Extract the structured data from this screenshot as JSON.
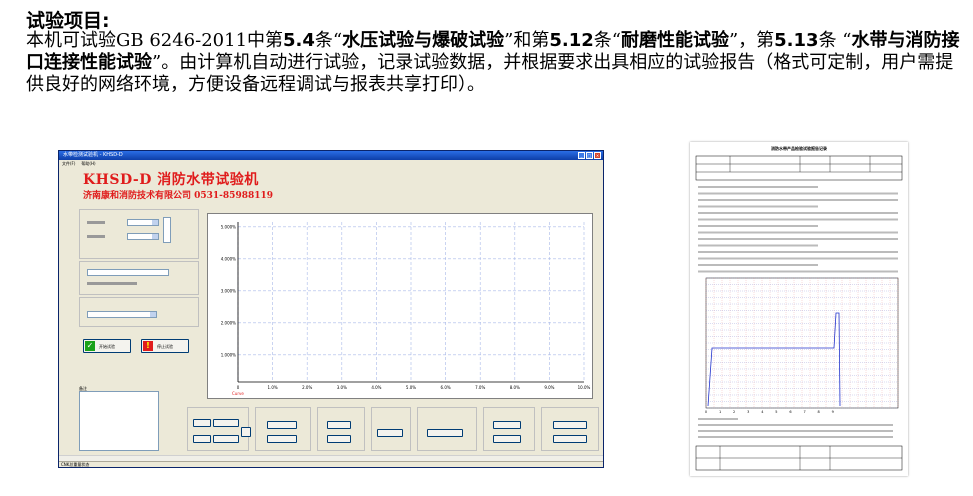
{
  "heading": "试验项目:",
  "paragraph": {
    "p1": "本机可试验GB 6246-2011中第",
    "s1": "5.4",
    "p2": "条“",
    "b1": "水压试验与爆破试验",
    "p3": "”和第",
    "s2": "5.12",
    "p4": "条“",
    "b2": "耐磨性能试验",
    "p5": "”，第",
    "s3": "5.13",
    "p6": "条 “",
    "b3": "水带与消防接口连接性能试验",
    "p7": "”。由计算机自动进行试验，记录试验数据，并根据要求出具相应的试验报告（格式可定制，用户需提供良好的网络环境，方便设备远程调试与报表共享打印）。"
  },
  "software": {
    "title_text": "水带检测试验机 - KHSD-D",
    "menu": [
      "文件(F)",
      "帮助(H)"
    ],
    "logo_name": "KHSD-D 消防水带试验机",
    "logo_company": "济南康和消防技术有限公司 0531-85988119",
    "start_button": "开始试验",
    "stop_button": "停止试验",
    "remarks_label": "备注",
    "status_text": "CNK总重量状态",
    "y_ticks": [
      "5.000%",
      "4.000%",
      "3.000%",
      "2.000%",
      "1.000%"
    ],
    "x_ticks": [
      "0",
      "1.0%",
      "2.0%",
      "3.0%",
      "4.0%",
      "5.0%",
      "6.0%",
      "7.0%",
      "8.0%",
      "9.0%",
      "10.0%"
    ],
    "x_origin_label": "0",
    "axis_caption": "Curve",
    "accent": "#e01c1c"
  },
  "report": {
    "title": "消防水带产品检验试验报告记录",
    "x_ticks": [
      "0",
      "1",
      "2",
      "3",
      "4",
      "5",
      "6",
      "7",
      "8",
      "9"
    ]
  }
}
